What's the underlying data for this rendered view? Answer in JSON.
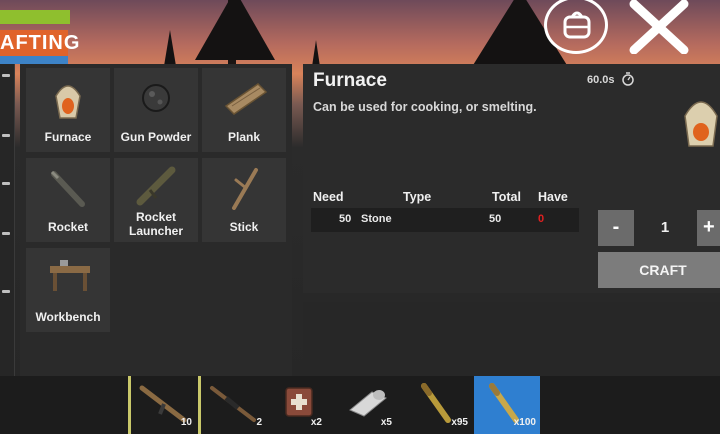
{
  "hud": {
    "crafting_label": "AFTING"
  },
  "recipes": [
    {
      "label": "Furnace",
      "icon": "furnace-icon"
    },
    {
      "label": "Gun Powder",
      "icon": "gunpowder-icon"
    },
    {
      "label": "Plank",
      "icon": "plank-icon"
    },
    {
      "label": "Rocket",
      "icon": "rocket-icon"
    },
    {
      "label": "Rocket Launcher",
      "icon": "rocket-launcher-icon"
    },
    {
      "label": "Stick",
      "icon": "stick-icon"
    },
    {
      "label": "Workbench",
      "icon": "workbench-icon"
    }
  ],
  "detail": {
    "title": "Furnace",
    "description": "Can be used for cooking, or smelting.",
    "craft_time": "60.0s",
    "columns": {
      "need": "Need",
      "type": "Type",
      "total": "Total",
      "have": "Have"
    },
    "requirements": [
      {
        "need": "50",
        "type": "Stone",
        "total": "50",
        "have": "0"
      }
    ],
    "have_color": "#e02020"
  },
  "craft": {
    "minus_label": "-",
    "quantity": "1",
    "plus_label": "+",
    "button_label": "CRAFT"
  },
  "hotbar": [
    {
      "icon": "rifle-icon",
      "count": "10"
    },
    {
      "icon": "bolt-rifle-icon",
      "count": "2"
    },
    {
      "icon": "medkit-icon",
      "count": "x2"
    },
    {
      "icon": "bandage-icon",
      "count": "x5"
    },
    {
      "icon": "rifle-ammo-icon",
      "count": "x95"
    },
    {
      "icon": "ammo-icon",
      "count": "x100"
    }
  ],
  "colors": {
    "crafting_tab": "#e0632a",
    "health": "#8fbf2e",
    "selected_slot": "#2f7fd0"
  }
}
